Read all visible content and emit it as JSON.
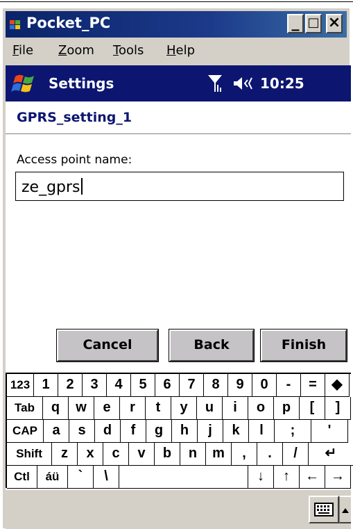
{
  "window": {
    "title": "Pocket_PC",
    "buttons": {
      "minimize": "_",
      "maximize": "□",
      "close": "×"
    }
  },
  "menubar": {
    "items": [
      {
        "label": "File",
        "accel": "F",
        "rest": "ile"
      },
      {
        "label": "Zoom",
        "accel": "Z",
        "rest": "oom"
      },
      {
        "label": "Tools",
        "accel": "T",
        "rest": "ools"
      },
      {
        "label": "Help",
        "accel": "H",
        "rest": "elp"
      }
    ]
  },
  "navbar": {
    "title": "Settings",
    "time": "10:25",
    "icons": [
      "windows-start-icon",
      "signal-icon",
      "speaker-icon"
    ]
  },
  "page": {
    "heading": "GPRS_setting_1",
    "field_label": "Access point name:",
    "field_value": "ze_gprs"
  },
  "buttons": {
    "cancel": "Cancel",
    "back": "Back",
    "finish": "Finish"
  },
  "keyboard": {
    "rows": [
      [
        "123",
        "1",
        "2",
        "3",
        "4",
        "5",
        "6",
        "7",
        "8",
        "9",
        "0",
        "-",
        "=",
        "◆"
      ],
      [
        "Tab",
        "q",
        "w",
        "e",
        "r",
        "t",
        "y",
        "u",
        "i",
        "o",
        "p",
        "[",
        "]"
      ],
      [
        "CAP",
        "a",
        "s",
        "d",
        "f",
        "g",
        "h",
        "j",
        "k",
        "l",
        ";",
        "'"
      ],
      [
        "Shift",
        "z",
        "x",
        "c",
        "v",
        "b",
        "n",
        "m",
        ",",
        ".",
        "/",
        "↵"
      ],
      [
        "Ctl",
        "áü",
        "`",
        "\\",
        "",
        "↓",
        "↑",
        "←",
        "→"
      ]
    ]
  },
  "colors": {
    "navbar": "#0c1670",
    "heading": "#0c1670",
    "titlebar": "#0a246a",
    "chrome": "#d4d0c8"
  }
}
